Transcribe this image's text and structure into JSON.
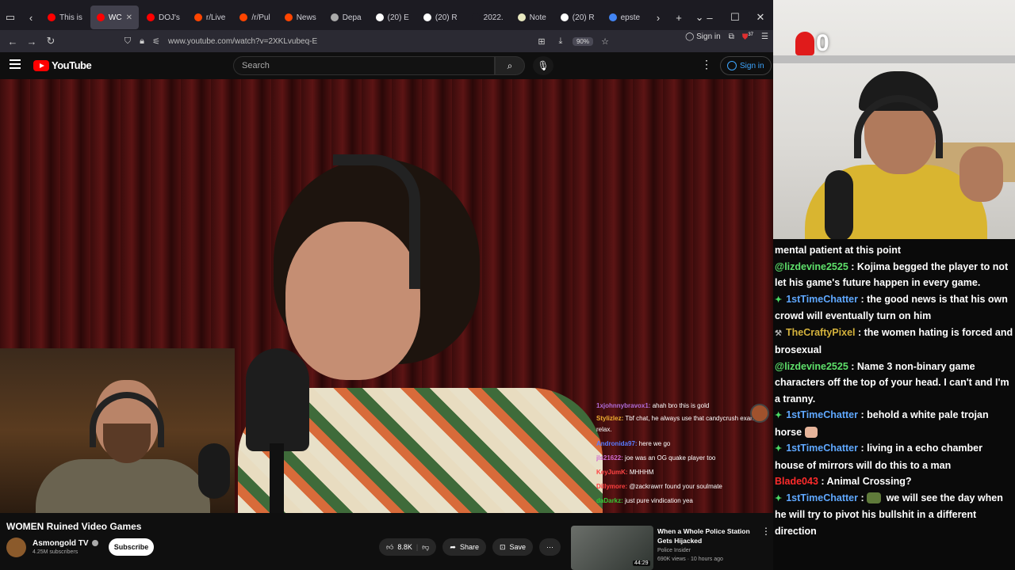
{
  "browser": {
    "tabs": [
      {
        "label": "This is",
        "fav_color": "#ff0000"
      },
      {
        "label": "WC",
        "fav_color": "#ff0000",
        "active": true
      },
      {
        "label": "DOJ's",
        "fav_color": "#ff0000"
      },
      {
        "label": "r/Live",
        "fav_color": "#ff4500"
      },
      {
        "label": "/r/Pul",
        "fav_color": "#ff4500"
      },
      {
        "label": "News",
        "fav_color": "#ff4500"
      },
      {
        "label": "Depa",
        "fav_color": "#aaaaaa"
      },
      {
        "label": "(20) E",
        "fav_color": "#ffffff"
      },
      {
        "label": "(20) R",
        "fav_color": "#ffffff"
      },
      {
        "label": "2022.",
        "fav_color": "#1c1b22"
      },
      {
        "label": "Note",
        "fav_color": "#e8e8c0"
      },
      {
        "label": "(20) R",
        "fav_color": "#ffffff"
      },
      {
        "label": "epste",
        "fav_color": "#4285f4"
      }
    ],
    "url": "www.youtube.com/watch?v=2XKLvubeq-E",
    "zoom": "90%",
    "sign_in": "Sign in",
    "ext_badge": "37"
  },
  "youtube": {
    "logo_text": "YouTube",
    "search_placeholder": "Search",
    "sign_in": "Sign in",
    "video_title": "WOMEN Ruined Video Games",
    "channel_name": "Asmongold TV",
    "subscribers": "4.25M subscribers",
    "subscribe_label": "Subscribe",
    "likes": "8.8K",
    "share_label": "Share",
    "save_label": "Save",
    "recommendation": {
      "title": "When a Whole Police Station Gets Hijacked",
      "channel": "Police Insider",
      "meta": "690K views · 10 hours ago",
      "duration": "44:29"
    }
  },
  "video_chat": [
    {
      "user": "1xjohnnybravox1:",
      "text": "ahah bro this is gold",
      "color": "#b06cd9"
    },
    {
      "user": "Stylizlez:",
      "text": "Tbf chat, he always use that candycrush example, relax.",
      "color": "#f0b030"
    },
    {
      "user": "Andronida97:",
      "text": "here we go",
      "color": "#5a7bff"
    },
    {
      "user": "jls21622:",
      "text": "joe was an OG quake player too",
      "color": "#d06bd0"
    },
    {
      "user": "KeyJumK:",
      "text": "MHHHM",
      "color": "#ff4444"
    },
    {
      "user": "Dillymore:",
      "text": "@zackrawrr found your soulmate",
      "color": "#ff3f3f"
    },
    {
      "user": "daDarkz:",
      "text": "just pure vindication yea",
      "color": "#35c935"
    }
  ],
  "stream_counter": "0",
  "right_chat": [
    {
      "user": "",
      "text": "mental patient at this point",
      "color": "#ffffff",
      "badge": ""
    },
    {
      "user": "@lizdevine2525",
      "text": " : Kojima begged the player to not let his game's future happen in every game.",
      "color": "#5ee06a",
      "badge": ""
    },
    {
      "user": "1stTimeChatter",
      "text": " : the good news is that his own crowd will eventually turn on him",
      "color": "#5fa8ff",
      "badge": "✦"
    },
    {
      "user": "TheCraftyPixel",
      "text": " : the women hating is forced and brosexual",
      "color": "#d4b23c",
      "badge": "⚒"
    },
    {
      "user": "@lizdevine2525",
      "text": " : Name 3 non-binary game characters off the top of your head. I can't and I'm a tranny.",
      "color": "#5ee06a",
      "badge": ""
    },
    {
      "user": "1stTimeChatter",
      "text": " : behold a white pale trojan horse",
      "color": "#5fa8ff",
      "badge": "✦",
      "emote": true
    },
    {
      "user": "1stTimeChatter",
      "text": " : living in a echo chamber house of mirrors will do this to a man",
      "color": "#5fa8ff",
      "badge": "✦"
    },
    {
      "user": "Blade043",
      "text": " : Animal Crossing?",
      "color": "#ff2b2b",
      "badge": ""
    },
    {
      "user": "1stTimeChatter",
      "text": " we will see the day when he will try to pivot his bullshit in a different direction",
      "color": "#5fa8ff",
      "badge": "✦",
      "prefix": " : ",
      "emote2": true
    }
  ]
}
